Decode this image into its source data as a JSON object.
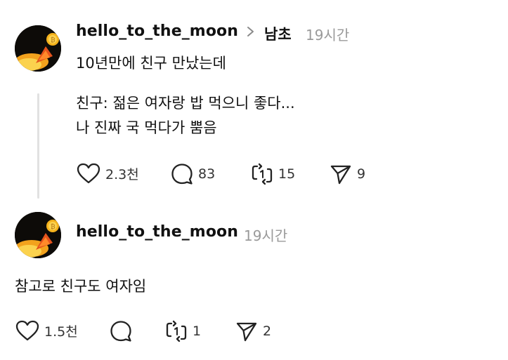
{
  "post": {
    "username": "hello_to_the_moon",
    "topic": "남초",
    "time": "19시간",
    "text": "10년만에 친구 만났는데",
    "quote_lines": [
      "친구: 젊은 여자랑 밥 먹으니 좋다...",
      "나 진짜 국 먹다가 뿜음"
    ],
    "actions": {
      "likes": "2.3천",
      "comments": "83",
      "reposts": "15",
      "shares": "9"
    }
  },
  "reply": {
    "username": "hello_to_the_moon",
    "time": "19시간",
    "text": "참고로 친구도 여자임",
    "actions": {
      "likes": "1.5천",
      "comments": "",
      "reposts": "1",
      "shares": "2"
    }
  },
  "icons": {
    "like": "heart-icon",
    "comment": "comment-bubble-icon",
    "repost": "repost-icon",
    "share": "send-icon",
    "chevron": "chevron-right-icon"
  },
  "colors": {
    "text": "#111111",
    "muted": "#9a9a9a",
    "thread_line": "#e1e1e1"
  }
}
